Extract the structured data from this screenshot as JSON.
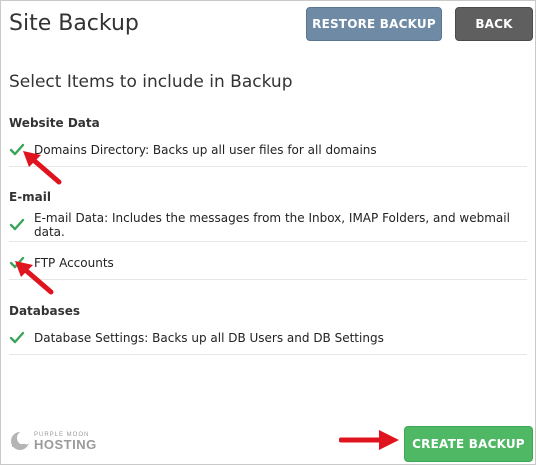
{
  "header": {
    "title": "Site Backup",
    "restore_label": "RESTORE BACKUP",
    "back_label": "BACK"
  },
  "main": {
    "subtitle": "Select Items to include in Backup",
    "sections": [
      {
        "title": "Website Data",
        "items": [
          "Domains Directory: Backs up all user files for all domains"
        ]
      },
      {
        "title": "E-mail",
        "items": [
          "E-mail Data: Includes the messages from the Inbox, IMAP Folders, and webmail data.",
          "FTP Accounts"
        ]
      },
      {
        "title": "Databases",
        "items": [
          "Database Settings: Backs up all DB Users and DB Settings"
        ]
      }
    ]
  },
  "footer": {
    "logo_small": "PURPLE MOON",
    "logo_big": "HOSTING",
    "create_label": "CREATE BACKUP"
  },
  "colors": {
    "check": "#3aa55a",
    "arrow": "#e0141e",
    "create_button": "#4fb865",
    "restore_button": "#6f8aa5",
    "back_button": "#5f5f5f"
  },
  "icons": [
    "checkmark-icon",
    "red-arrow-icon",
    "moon-logo-icon"
  ]
}
